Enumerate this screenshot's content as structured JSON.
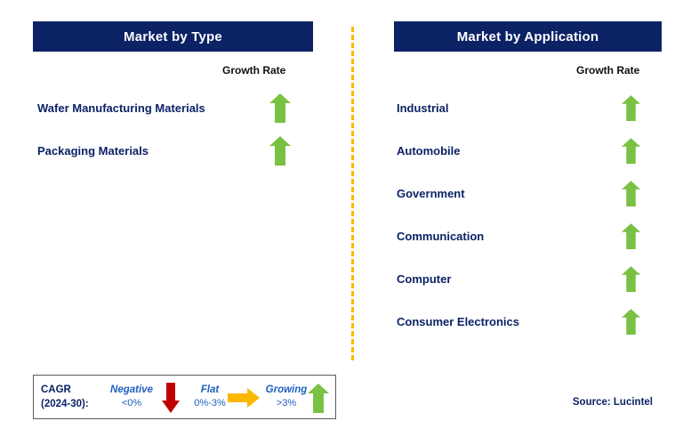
{
  "panels": [
    {
      "id": "market-by-type",
      "header": "Market by Type",
      "growth_label": "Growth Rate",
      "rows": [
        {
          "label": "Wafer Manufacturing Materials",
          "growth": "up",
          "icon": "arrow-up-icon"
        },
        {
          "label": "Packaging Materials",
          "growth": "up",
          "icon": "arrow-up-icon"
        }
      ]
    },
    {
      "id": "market-by-application",
      "header": "Market by Application",
      "growth_label": "Growth Rate",
      "rows": [
        {
          "label": "Industrial",
          "growth": "up",
          "icon": "arrow-up-icon"
        },
        {
          "label": "Automobile",
          "growth": "up",
          "icon": "arrow-up-icon"
        },
        {
          "label": "Government",
          "growth": "up",
          "icon": "arrow-up-icon"
        },
        {
          "label": "Communication",
          "growth": "up",
          "icon": "arrow-up-icon"
        },
        {
          "label": "Computer",
          "growth": "up",
          "icon": "arrow-up-icon"
        },
        {
          "label": "Consumer Electronics",
          "growth": "up",
          "icon": "arrow-up-icon"
        }
      ]
    }
  ],
  "legend": {
    "cagr_line1": "CAGR",
    "cagr_line2": "(2024-30):",
    "items": [
      {
        "title": "Negative",
        "range": "<0%",
        "icon": "arrow-down-icon",
        "color": "#c00000"
      },
      {
        "title": "Flat",
        "range": "0%-3%",
        "icon": "arrow-right-icon",
        "color": "#fcb800"
      },
      {
        "title": "Growing",
        "range": ">3%",
        "icon": "arrow-up-icon",
        "color": "#79c143"
      }
    ]
  },
  "source": "Source: Lucintel",
  "colors": {
    "header_bar": "#0b2265",
    "header_text": "#ffffff",
    "label_text": "#0b2265",
    "growth_label_text": "#101010",
    "arrow_green": "#79c143",
    "arrow_red": "#c00000",
    "arrow_yellow": "#fcb800",
    "divider_dashed": "#fcb800",
    "legend_border": "#5a5a5a",
    "legend_title_text": "#1f5fbf",
    "background": "#ffffff"
  }
}
